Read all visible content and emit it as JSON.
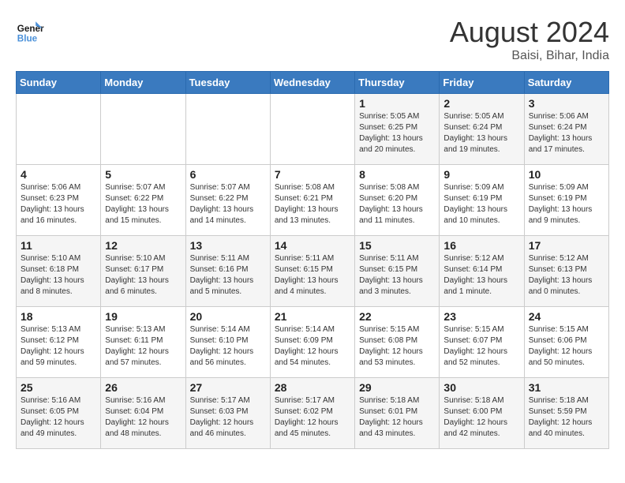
{
  "header": {
    "logo_line1": "General",
    "logo_line2": "Blue",
    "month_year": "August 2024",
    "location": "Baisi, Bihar, India"
  },
  "days_of_week": [
    "Sunday",
    "Monday",
    "Tuesday",
    "Wednesday",
    "Thursday",
    "Friday",
    "Saturday"
  ],
  "weeks": [
    [
      {
        "day": "",
        "info": ""
      },
      {
        "day": "",
        "info": ""
      },
      {
        "day": "",
        "info": ""
      },
      {
        "day": "",
        "info": ""
      },
      {
        "day": "1",
        "info": "Sunrise: 5:05 AM\nSunset: 6:25 PM\nDaylight: 13 hours\nand 20 minutes."
      },
      {
        "day": "2",
        "info": "Sunrise: 5:05 AM\nSunset: 6:24 PM\nDaylight: 13 hours\nand 19 minutes."
      },
      {
        "day": "3",
        "info": "Sunrise: 5:06 AM\nSunset: 6:24 PM\nDaylight: 13 hours\nand 17 minutes."
      }
    ],
    [
      {
        "day": "4",
        "info": "Sunrise: 5:06 AM\nSunset: 6:23 PM\nDaylight: 13 hours\nand 16 minutes."
      },
      {
        "day": "5",
        "info": "Sunrise: 5:07 AM\nSunset: 6:22 PM\nDaylight: 13 hours\nand 15 minutes."
      },
      {
        "day": "6",
        "info": "Sunrise: 5:07 AM\nSunset: 6:22 PM\nDaylight: 13 hours\nand 14 minutes."
      },
      {
        "day": "7",
        "info": "Sunrise: 5:08 AM\nSunset: 6:21 PM\nDaylight: 13 hours\nand 13 minutes."
      },
      {
        "day": "8",
        "info": "Sunrise: 5:08 AM\nSunset: 6:20 PM\nDaylight: 13 hours\nand 11 minutes."
      },
      {
        "day": "9",
        "info": "Sunrise: 5:09 AM\nSunset: 6:19 PM\nDaylight: 13 hours\nand 10 minutes."
      },
      {
        "day": "10",
        "info": "Sunrise: 5:09 AM\nSunset: 6:19 PM\nDaylight: 13 hours\nand 9 minutes."
      }
    ],
    [
      {
        "day": "11",
        "info": "Sunrise: 5:10 AM\nSunset: 6:18 PM\nDaylight: 13 hours\nand 8 minutes."
      },
      {
        "day": "12",
        "info": "Sunrise: 5:10 AM\nSunset: 6:17 PM\nDaylight: 13 hours\nand 6 minutes."
      },
      {
        "day": "13",
        "info": "Sunrise: 5:11 AM\nSunset: 6:16 PM\nDaylight: 13 hours\nand 5 minutes."
      },
      {
        "day": "14",
        "info": "Sunrise: 5:11 AM\nSunset: 6:15 PM\nDaylight: 13 hours\nand 4 minutes."
      },
      {
        "day": "15",
        "info": "Sunrise: 5:11 AM\nSunset: 6:15 PM\nDaylight: 13 hours\nand 3 minutes."
      },
      {
        "day": "16",
        "info": "Sunrise: 5:12 AM\nSunset: 6:14 PM\nDaylight: 13 hours\nand 1 minute."
      },
      {
        "day": "17",
        "info": "Sunrise: 5:12 AM\nSunset: 6:13 PM\nDaylight: 13 hours\nand 0 minutes."
      }
    ],
    [
      {
        "day": "18",
        "info": "Sunrise: 5:13 AM\nSunset: 6:12 PM\nDaylight: 12 hours\nand 59 minutes."
      },
      {
        "day": "19",
        "info": "Sunrise: 5:13 AM\nSunset: 6:11 PM\nDaylight: 12 hours\nand 57 minutes."
      },
      {
        "day": "20",
        "info": "Sunrise: 5:14 AM\nSunset: 6:10 PM\nDaylight: 12 hours\nand 56 minutes."
      },
      {
        "day": "21",
        "info": "Sunrise: 5:14 AM\nSunset: 6:09 PM\nDaylight: 12 hours\nand 54 minutes."
      },
      {
        "day": "22",
        "info": "Sunrise: 5:15 AM\nSunset: 6:08 PM\nDaylight: 12 hours\nand 53 minutes."
      },
      {
        "day": "23",
        "info": "Sunrise: 5:15 AM\nSunset: 6:07 PM\nDaylight: 12 hours\nand 52 minutes."
      },
      {
        "day": "24",
        "info": "Sunrise: 5:15 AM\nSunset: 6:06 PM\nDaylight: 12 hours\nand 50 minutes."
      }
    ],
    [
      {
        "day": "25",
        "info": "Sunrise: 5:16 AM\nSunset: 6:05 PM\nDaylight: 12 hours\nand 49 minutes."
      },
      {
        "day": "26",
        "info": "Sunrise: 5:16 AM\nSunset: 6:04 PM\nDaylight: 12 hours\nand 48 minutes."
      },
      {
        "day": "27",
        "info": "Sunrise: 5:17 AM\nSunset: 6:03 PM\nDaylight: 12 hours\nand 46 minutes."
      },
      {
        "day": "28",
        "info": "Sunrise: 5:17 AM\nSunset: 6:02 PM\nDaylight: 12 hours\nand 45 minutes."
      },
      {
        "day": "29",
        "info": "Sunrise: 5:18 AM\nSunset: 6:01 PM\nDaylight: 12 hours\nand 43 minutes."
      },
      {
        "day": "30",
        "info": "Sunrise: 5:18 AM\nSunset: 6:00 PM\nDaylight: 12 hours\nand 42 minutes."
      },
      {
        "day": "31",
        "info": "Sunrise: 5:18 AM\nSunset: 5:59 PM\nDaylight: 12 hours\nand 40 minutes."
      }
    ]
  ]
}
